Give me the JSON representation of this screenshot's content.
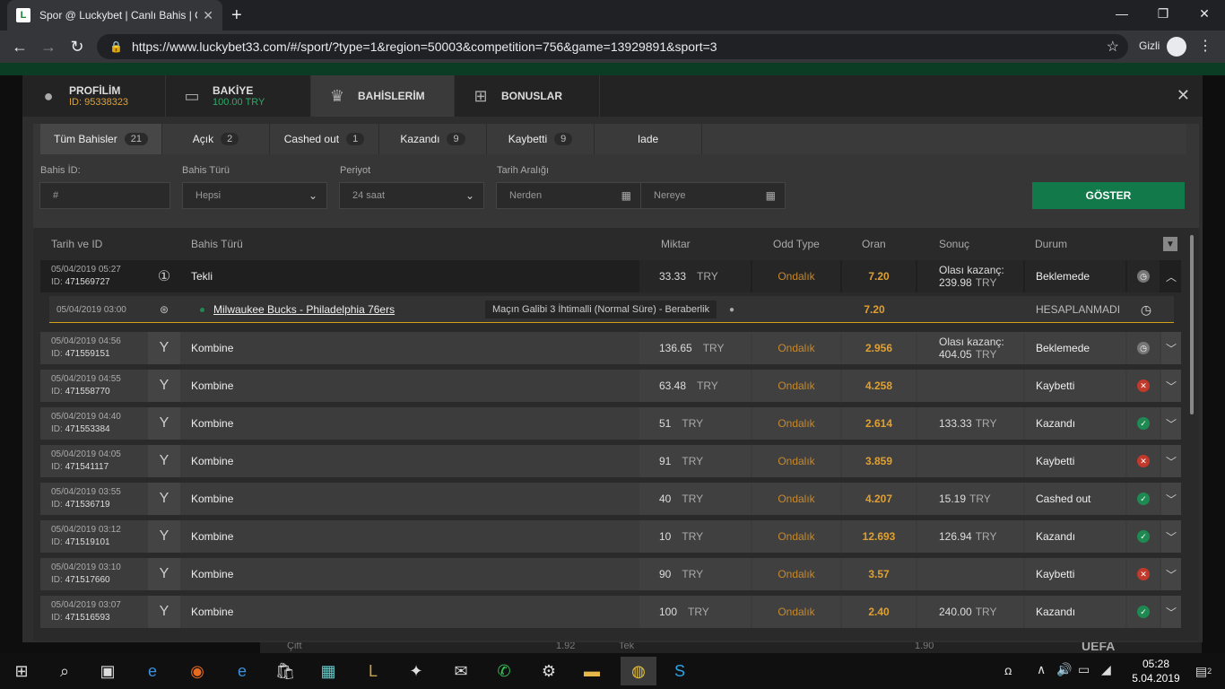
{
  "browser": {
    "tab_title": "Spor @ Luckybet | Canlı Bahis | C",
    "url": "https://www.luckybet33.com/#/sport/?type=1&region=50003&competition=756&game=13929891&sport=3",
    "incognito_label": "Gizli"
  },
  "modal": {
    "tabs": [
      {
        "title": "PROFİLİM",
        "sub": "ID: 95338323",
        "sub_color": "#e0a030"
      },
      {
        "title": "BAKİYE",
        "sub": "100.00 TRY",
        "sub_color": "#2fa868"
      },
      {
        "title": "BAHİSLERİM",
        "sub": ""
      },
      {
        "title": "BONUSLAR",
        "sub": ""
      }
    ],
    "close": "✕"
  },
  "filters": {
    "tabs": [
      {
        "label": "Tüm Bahisler",
        "count": "21"
      },
      {
        "label": "Açık",
        "count": "2"
      },
      {
        "label": "Cashed out",
        "count": "1"
      },
      {
        "label": "Kazandı",
        "count": "9"
      },
      {
        "label": "Kaybetti",
        "count": "9"
      },
      {
        "label": "Iade",
        "count": ""
      }
    ],
    "bet_id_label": "Bahis İD:",
    "bet_id_placeholder": "#",
    "bet_type_label": "Bahis Türü",
    "bet_type_value": "Hepsi",
    "period_label": "Periyot",
    "period_value": "24 saat",
    "date_range_label": "Tarih Aralığı",
    "from_placeholder": "Nerden",
    "to_placeholder": "Nereye",
    "show_button": "GÖSTER"
  },
  "table": {
    "headers": {
      "date_id": "Tarih ve ID",
      "bet_type": "Bahis Türü",
      "amount": "Miktar",
      "odd_type": "Odd Type",
      "odds": "Oran",
      "result": "Sonuç",
      "status": "Durum"
    },
    "rows": [
      {
        "date": "05/04/2019 05:27",
        "id_label": "ID: ",
        "id": "471569727",
        "type": "Tekli",
        "amount": "33.33",
        "currency": "TRY",
        "odd_type": "Ondalık",
        "odds": "7.20",
        "result_label": "Olası kazanç:",
        "result": "239.98",
        "result_cur": "TRY",
        "status": "Beklemede",
        "state": "pending"
      },
      {
        "date": "05/04/2019 04:56",
        "id_label": "ID: ",
        "id": "471559151",
        "type": "Kombine",
        "amount": "136.65",
        "currency": "TRY",
        "odd_type": "Ondalık",
        "odds": "2.956",
        "result_label": "Olası kazanç:",
        "result": "404.05",
        "result_cur": "TRY",
        "status": "Beklemede",
        "state": "pending"
      },
      {
        "date": "05/04/2019 04:55",
        "id_label": "ID: ",
        "id": "471558770",
        "type": "Kombine",
        "amount": "63.48",
        "currency": "TRY",
        "odd_type": "Ondalık",
        "odds": "4.258",
        "result_label": "",
        "result": "",
        "result_cur": "",
        "status": "Kaybetti",
        "state": "lost"
      },
      {
        "date": "05/04/2019 04:40",
        "id_label": "ID: ",
        "id": "471553384",
        "type": "Kombine",
        "amount": "51",
        "currency": "TRY",
        "odd_type": "Ondalık",
        "odds": "2.614",
        "result_label": "",
        "result": "133.33",
        "result_cur": "TRY",
        "status": "Kazandı",
        "state": "won"
      },
      {
        "date": "05/04/2019 04:05",
        "id_label": "ID: ",
        "id": "471541117",
        "type": "Kombine",
        "amount": "91",
        "currency": "TRY",
        "odd_type": "Ondalık",
        "odds": "3.859",
        "result_label": "",
        "result": "",
        "result_cur": "",
        "status": "Kaybetti",
        "state": "lost"
      },
      {
        "date": "05/04/2019 03:55",
        "id_label": "ID: ",
        "id": "471536719",
        "type": "Kombine",
        "amount": "40",
        "currency": "TRY",
        "odd_type": "Ondalık",
        "odds": "4.207",
        "result_label": "",
        "result": "15.19",
        "result_cur": "TRY",
        "status": "Cashed out",
        "state": "won"
      },
      {
        "date": "05/04/2019 03:12",
        "id_label": "ID: ",
        "id": "471519101",
        "type": "Kombine",
        "amount": "10",
        "currency": "TRY",
        "odd_type": "Ondalık",
        "odds": "12.693",
        "result_label": "",
        "result": "126.94",
        "result_cur": "TRY",
        "status": "Kazandı",
        "state": "won"
      },
      {
        "date": "05/04/2019 03:10",
        "id_label": "ID: ",
        "id": "471517660",
        "type": "Kombine",
        "amount": "90",
        "currency": "TRY",
        "odd_type": "Ondalık",
        "odds": "3.57",
        "result_label": "",
        "result": "",
        "result_cur": "",
        "status": "Kaybetti",
        "state": "lost"
      },
      {
        "date": "05/04/2019 03:07",
        "id_label": "ID: ",
        "id": "471516593",
        "type": "Kombine",
        "amount": "100",
        "currency": "TRY",
        "odd_type": "Ondalık",
        "odds": "2.40",
        "result_label": "",
        "result": "240.00",
        "result_cur": "TRY",
        "status": "Kazandı",
        "state": "won"
      }
    ],
    "selection": {
      "date": "05/04/2019 03:00",
      "match": "Milwaukee Bucks - Philadelphia 76ers",
      "market": "Maçın Galibi 3 İhtimalli (Normal Süre) - Beraberlik",
      "odds": "7.20",
      "status": "HESAPLANMADI"
    }
  },
  "background": {
    "bottom_left": "Çift",
    "bottom_left_odds": "1.92",
    "bottom_right": "Tek",
    "bottom_right_odds": "1.90",
    "uefa": "UEFA"
  },
  "taskbar": {
    "time": "05:28",
    "date": "5.04.2019",
    "notif_count": "2"
  }
}
